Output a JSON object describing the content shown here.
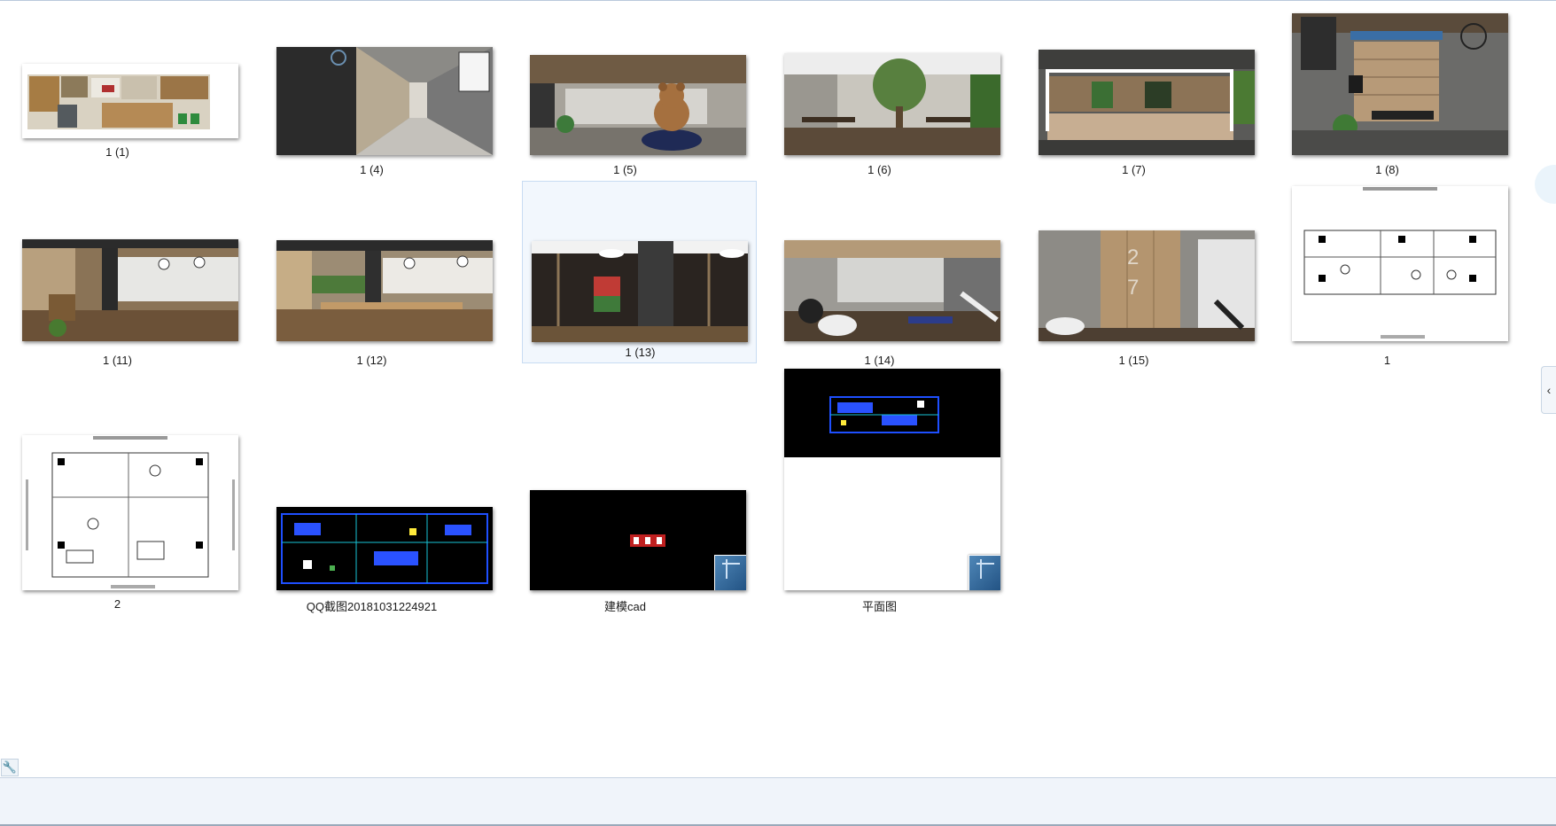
{
  "window": {
    "accent": "#c8dcf3",
    "selected_bg": "#f2f7fd"
  },
  "files": [
    {
      "label": "1 (1)",
      "kind": "render",
      "scene": "plan-color",
      "selected": false
    },
    {
      "label": "1 (4)",
      "kind": "render",
      "scene": "corridor",
      "selected": false
    },
    {
      "label": "1 (5)",
      "kind": "render",
      "scene": "bear-lounge",
      "selected": false
    },
    {
      "label": "1 (6)",
      "kind": "render",
      "scene": "tree-dining",
      "selected": false
    },
    {
      "label": "1 (7)",
      "kind": "render",
      "scene": "bar-counter",
      "selected": false
    },
    {
      "label": "1 (8)",
      "kind": "render",
      "scene": "bookshelf",
      "selected": false
    },
    {
      "label": "1 (11)",
      "kind": "render",
      "scene": "restaurant-a",
      "selected": false
    },
    {
      "label": "1 (12)",
      "kind": "render",
      "scene": "restaurant-b",
      "selected": false
    },
    {
      "label": "1 (13)",
      "kind": "render",
      "scene": "column-view",
      "selected": true
    },
    {
      "label": "1 (14)",
      "kind": "render",
      "scene": "gym-a",
      "selected": false
    },
    {
      "label": "1 (15)",
      "kind": "render",
      "scene": "gym-b",
      "selected": false
    },
    {
      "label": "1",
      "kind": "drawing",
      "scene": "plan-white-wide",
      "selected": false
    },
    {
      "label": "2",
      "kind": "drawing",
      "scene": "plan-white",
      "selected": false
    },
    {
      "label": "QQ截图20181031224921",
      "kind": "screenshot",
      "scene": "cad-black",
      "selected": false
    },
    {
      "label": "建模cad",
      "kind": "dwg",
      "scene": "cad-small",
      "selected": false
    },
    {
      "label": "平面图",
      "kind": "dwg",
      "scene": "cad-split",
      "selected": false
    }
  ],
  "icons": {
    "collapse": "chevron-left-icon",
    "settings": "wrench-icon",
    "dwg_badge": "autocad-file-icon"
  },
  "glyphs": {
    "collapse": "‹",
    "wrench": "🔧"
  }
}
